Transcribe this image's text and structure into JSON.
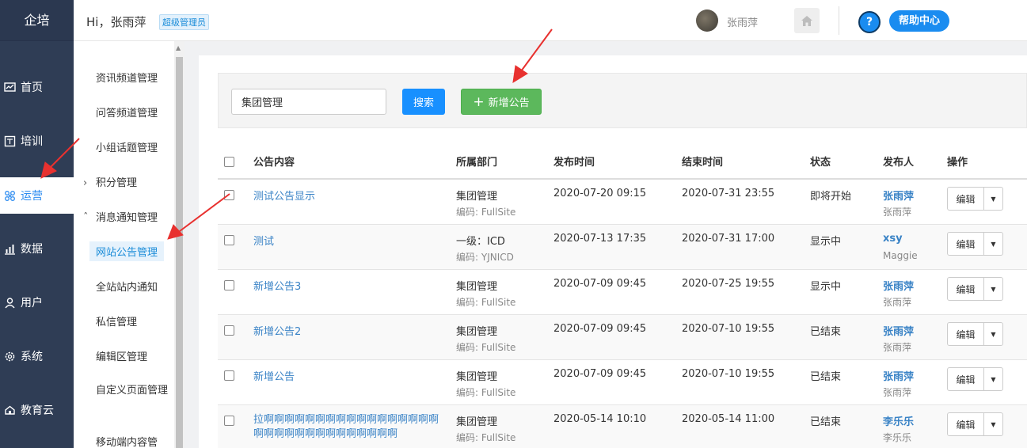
{
  "app": {
    "logo": "企培"
  },
  "nav": {
    "items": [
      {
        "label": "首页",
        "icon": "chart-line-icon"
      },
      {
        "label": "培训",
        "icon": "book-icon"
      },
      {
        "label": "运营",
        "icon": "operation-icon",
        "active": true
      },
      {
        "label": "数据",
        "icon": "bar-chart-icon"
      },
      {
        "label": "用户",
        "icon": "user-icon"
      },
      {
        "label": "系统",
        "icon": "gear-icon"
      },
      {
        "label": "教育云",
        "icon": "cloud-icon"
      }
    ]
  },
  "header": {
    "greeting": "Hi，张雨萍",
    "role": "超级管理员",
    "username": "张雨萍",
    "help_icon_text": "?",
    "help_label": "帮助中心"
  },
  "submenu": {
    "items": [
      {
        "label": "资讯频道管理"
      },
      {
        "label": "问答频道管理"
      },
      {
        "label": "小组话题管理"
      },
      {
        "label": "积分管理",
        "group": true,
        "caret": "›"
      },
      {
        "label": "消息通知管理",
        "group": true,
        "caret": "ˆ"
      },
      {
        "label": "网站公告管理",
        "active": true
      },
      {
        "label": "全站站内通知"
      },
      {
        "label": "私信管理"
      },
      {
        "label": "编辑区管理"
      },
      {
        "label": "自定义页面管理"
      },
      {
        "label": "移动端内容管"
      }
    ]
  },
  "search": {
    "value": "集团管理",
    "button": "搜索",
    "add_button": "新增公告",
    "add_icon": "+"
  },
  "table": {
    "columns": [
      "公告内容",
      "所属部门",
      "发布时间",
      "结束时间",
      "状态",
      "发布人",
      "操作"
    ],
    "code_prefix": "编码: ",
    "edit_label": "编辑",
    "rows": [
      {
        "title": "测试公告显示",
        "dept": "集团管理",
        "code": "FullSite",
        "start": "2020-07-20 09:15",
        "end": "2020-07-31 23:55",
        "status": "即将开始",
        "publisher": "张雨萍",
        "publisher_sub": "张雨萍"
      },
      {
        "title": "测试",
        "dept": "一级：ICD",
        "code": "YJNICD",
        "start": "2020-07-13 17:35",
        "end": "2020-07-31 17:00",
        "status": "显示中",
        "publisher": "xsy",
        "publisher_sub": "Maggie"
      },
      {
        "title": "新增公告3",
        "dept": "集团管理",
        "code": "FullSite",
        "start": "2020-07-09 09:45",
        "end": "2020-07-25 19:55",
        "status": "显示中",
        "publisher": "张雨萍",
        "publisher_sub": "张雨萍"
      },
      {
        "title": "新增公告2",
        "dept": "集团管理",
        "code": "FullSite",
        "start": "2020-07-09 09:45",
        "end": "2020-07-10 19:55",
        "status": "已结束",
        "publisher": "张雨萍",
        "publisher_sub": "张雨萍"
      },
      {
        "title": "新增公告",
        "dept": "集团管理",
        "code": "FullSite",
        "start": "2020-07-09 09:45",
        "end": "2020-07-10 19:55",
        "status": "已结束",
        "publisher": "张雨萍",
        "publisher_sub": "张雨萍"
      },
      {
        "title": "拉啊啊啊啊啊啊啊啊啊啊啊啊啊啊啊啊啊啊啊啊啊啊啊啊啊啊啊啊啊啊啊",
        "dept": "集团管理",
        "code": "FullSite",
        "start": "2020-05-14 10:10",
        "end": "2020-05-14 11:00",
        "status": "已结束",
        "publisher": "李乐乐",
        "publisher_sub": "李乐乐"
      }
    ]
  },
  "colors": {
    "nav_bg": "#2f3d55",
    "accent": "#1890ff",
    "add_green": "#5cb85c",
    "link": "#3a83c6",
    "arrow": "#e8312f"
  }
}
